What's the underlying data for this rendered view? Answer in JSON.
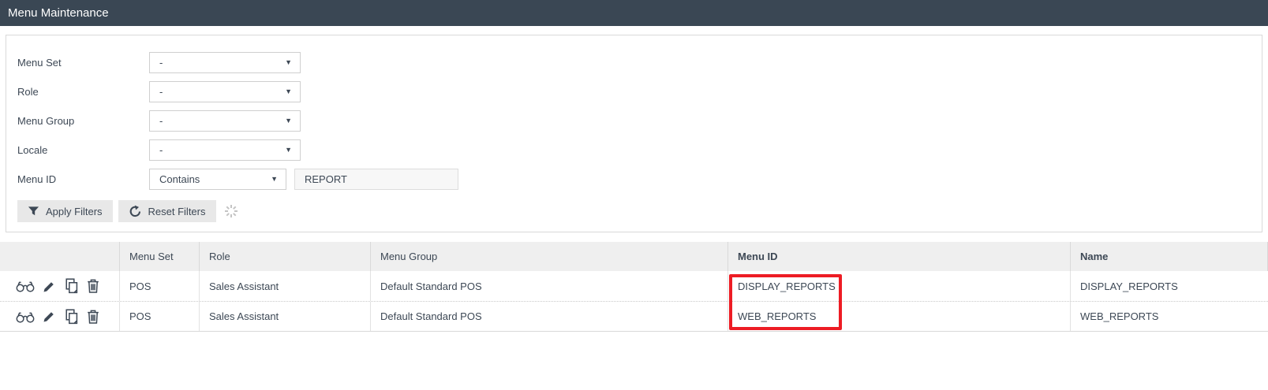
{
  "header": {
    "title": "Menu Maintenance"
  },
  "filters": {
    "fields": [
      {
        "label": "Menu Set",
        "value": "-"
      },
      {
        "label": "Role",
        "value": "-"
      },
      {
        "label": "Menu Group",
        "value": "-"
      },
      {
        "label": "Locale",
        "value": "-"
      },
      {
        "label": "Menu ID",
        "operator": "Contains",
        "value": "REPORT"
      }
    ],
    "apply_label": "Apply Filters",
    "reset_label": "Reset Filters"
  },
  "table": {
    "columns": [
      "",
      "Menu Set",
      "Role",
      "Menu Group",
      "Menu ID",
      "Name"
    ],
    "row_actions": [
      "view",
      "edit",
      "copy",
      "delete"
    ],
    "rows": [
      {
        "menu_set": "POS",
        "role": "Sales Assistant",
        "menu_group": "Default Standard POS",
        "menu_id": "DISPLAY_REPORTS",
        "name": "DISPLAY_REPORTS"
      },
      {
        "menu_set": "POS",
        "role": "Sales Assistant",
        "menu_group": "Default Standard POS",
        "menu_id": "WEB_REPORTS",
        "name": "WEB_REPORTS"
      }
    ]
  },
  "icons": {
    "caret": "▼"
  },
  "colors": {
    "header_bg": "#3a4754",
    "highlight_red": "#ed1c24",
    "text": "#3d4855",
    "table_header_bg": "#efefef",
    "button_bg": "#e8e8e8"
  }
}
